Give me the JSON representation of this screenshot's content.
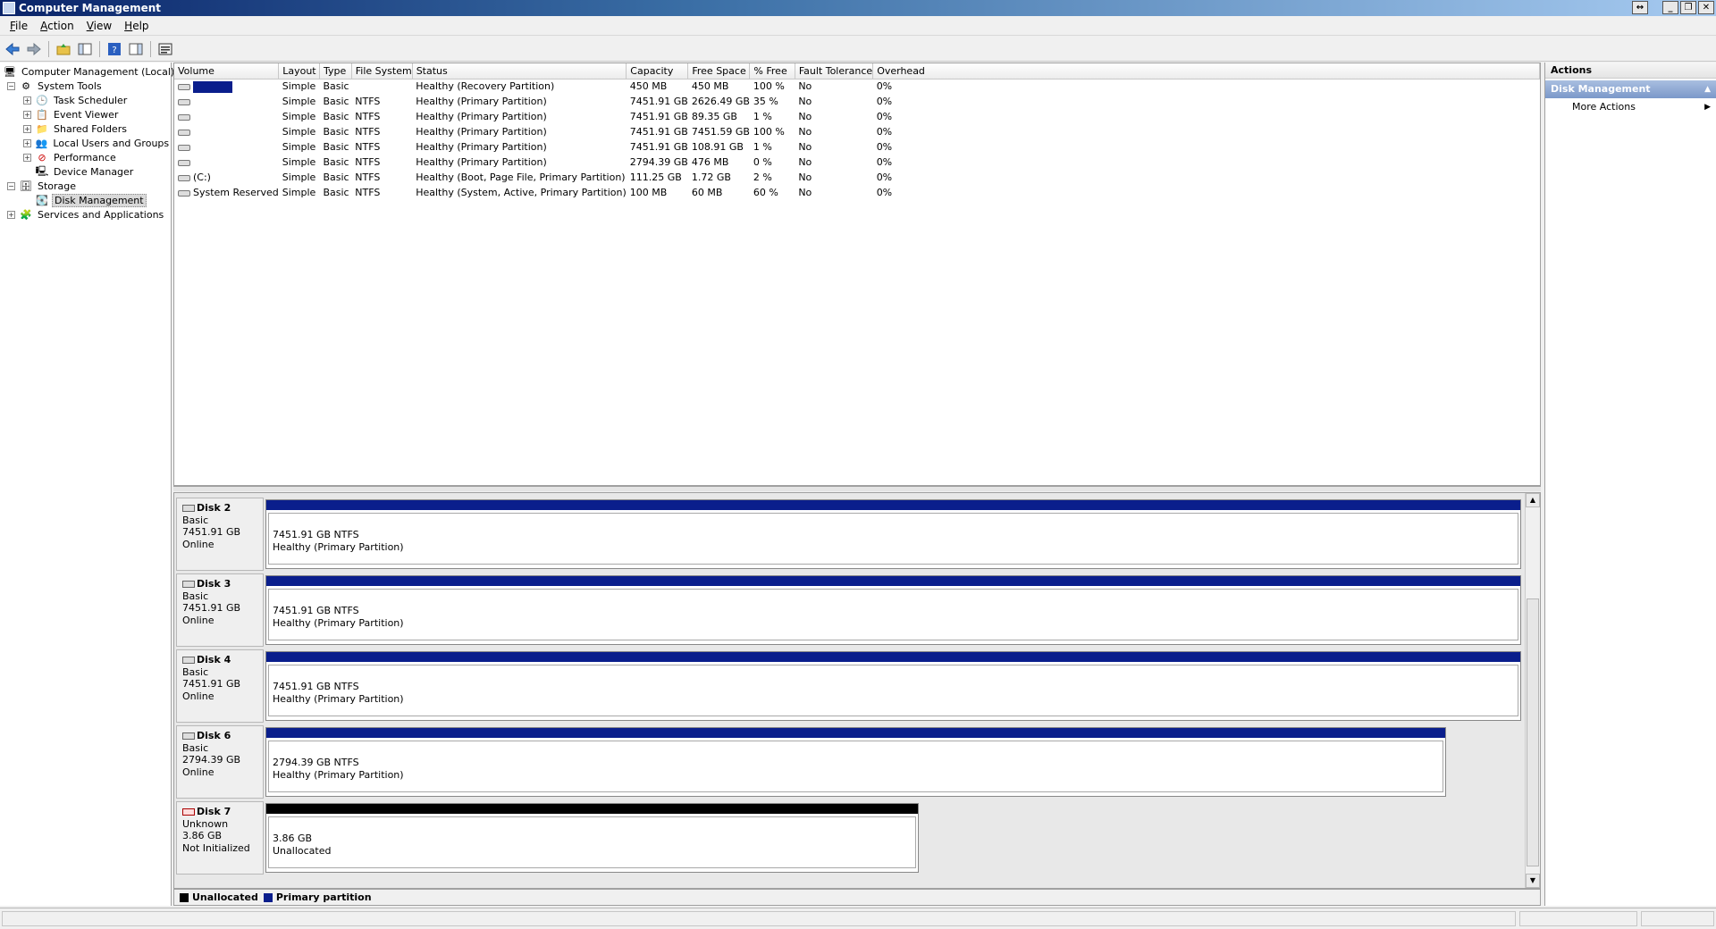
{
  "window": {
    "title": "Computer Management"
  },
  "menu": [
    {
      "first": "F",
      "rest": "ile"
    },
    {
      "first": "A",
      "rest": "ction"
    },
    {
      "first": "V",
      "rest": "iew"
    },
    {
      "first": "H",
      "rest": "elp"
    }
  ],
  "toolbar": {
    "icons": [
      "back-arrow-icon",
      "forward-arrow-icon",
      "up-folder-icon",
      "show-hide-tree-icon",
      "help-icon",
      "show-hide-action-pane-icon",
      "properties-icon"
    ]
  },
  "tree": {
    "root": "Computer Management (Local)",
    "system_tools": "System Tools",
    "task_scheduler": "Task Scheduler",
    "event_viewer": "Event Viewer",
    "shared_folders": "Shared Folders",
    "local_users": "Local Users and Groups",
    "performance": "Performance",
    "device_manager": "Device Manager",
    "storage": "Storage",
    "disk_management": "Disk Management",
    "services": "Services and Applications"
  },
  "volumes": {
    "headers": [
      "Volume",
      "Layout",
      "Type",
      "File System",
      "Status",
      "Capacity",
      "Free Space",
      "% Free",
      "Fault Tolerance",
      "Overhead"
    ],
    "rows": [
      {
        "volume": "",
        "layout": "Simple",
        "type": "Basic",
        "fs": "",
        "status": "Healthy (Recovery Partition)",
        "capacity": "450 MB",
        "free": "450 MB",
        "pct": "100 %",
        "fault": "No",
        "overhead": "0%"
      },
      {
        "volume": "",
        "layout": "Simple",
        "type": "Basic",
        "fs": "NTFS",
        "status": "Healthy (Primary Partition)",
        "capacity": "7451.91 GB",
        "free": "2626.49 GB",
        "pct": "35 %",
        "fault": "No",
        "overhead": "0%"
      },
      {
        "volume": "",
        "layout": "Simple",
        "type": "Basic",
        "fs": "NTFS",
        "status": "Healthy (Primary Partition)",
        "capacity": "7451.91 GB",
        "free": "89.35 GB",
        "pct": "1 %",
        "fault": "No",
        "overhead": "0%"
      },
      {
        "volume": "",
        "layout": "Simple",
        "type": "Basic",
        "fs": "NTFS",
        "status": "Healthy (Primary Partition)",
        "capacity": "7451.91 GB",
        "free": "7451.59 GB",
        "pct": "100 %",
        "fault": "No",
        "overhead": "0%"
      },
      {
        "volume": "",
        "layout": "Simple",
        "type": "Basic",
        "fs": "NTFS",
        "status": "Healthy (Primary Partition)",
        "capacity": "7451.91 GB",
        "free": "108.91 GB",
        "pct": "1 %",
        "fault": "No",
        "overhead": "0%"
      },
      {
        "volume": "",
        "layout": "Simple",
        "type": "Basic",
        "fs": "NTFS",
        "status": "Healthy (Primary Partition)",
        "capacity": "2794.39 GB",
        "free": "476 MB",
        "pct": "0 %",
        "fault": "No",
        "overhead": "0%"
      },
      {
        "volume": "(C:)",
        "layout": "Simple",
        "type": "Basic",
        "fs": "NTFS",
        "status": "Healthy (Boot, Page File, Primary Partition)",
        "capacity": "111.25 GB",
        "free": "1.72 GB",
        "pct": "2 %",
        "fault": "No",
        "overhead": "0%"
      },
      {
        "volume": "System Reserved",
        "layout": "Simple",
        "type": "Basic",
        "fs": "NTFS",
        "status": "Healthy (System, Active, Primary Partition)",
        "capacity": "100 MB",
        "free": "60 MB",
        "pct": "60 %",
        "fault": "No",
        "overhead": "0%"
      }
    ]
  },
  "disks": [
    {
      "name": "Disk 2",
      "type": "Basic",
      "size": "7451.91 GB",
      "state": "Online",
      "part_line1": "7451.91 GB NTFS",
      "part_line2": "Healthy (Primary Partition)",
      "kind": "primary",
      "fill": 1.0
    },
    {
      "name": "Disk 3",
      "type": "Basic",
      "size": "7451.91 GB",
      "state": "Online",
      "part_line1": "7451.91 GB NTFS",
      "part_line2": "Healthy (Primary Partition)",
      "kind": "primary",
      "fill": 1.0
    },
    {
      "name": "Disk 4",
      "type": "Basic",
      "size": "7451.91 GB",
      "state": "Online",
      "part_line1": "7451.91 GB NTFS",
      "part_line2": "Healthy (Primary Partition)",
      "kind": "primary",
      "fill": 1.0
    },
    {
      "name": "Disk 6",
      "type": "Basic",
      "size": "2794.39 GB",
      "state": "Online",
      "part_line1": "2794.39 GB NTFS",
      "part_line2": "Healthy (Primary Partition)",
      "kind": "primary",
      "fill": 0.94
    },
    {
      "name": "Disk 7",
      "type": "Unknown",
      "size": "3.86 GB",
      "state": "Not Initialized",
      "part_line1": "3.86 GB",
      "part_line2": "Unallocated",
      "kind": "unalloc",
      "fill": 0.52
    }
  ],
  "legend": {
    "unallocated": "Unallocated",
    "primary": "Primary partition"
  },
  "actions": {
    "header": "Actions",
    "section": "Disk Management",
    "more": "More Actions"
  },
  "colors": {
    "primary_partition": "#0a1e8c",
    "unallocated": "#000000",
    "selection": "#0a1e8c"
  }
}
